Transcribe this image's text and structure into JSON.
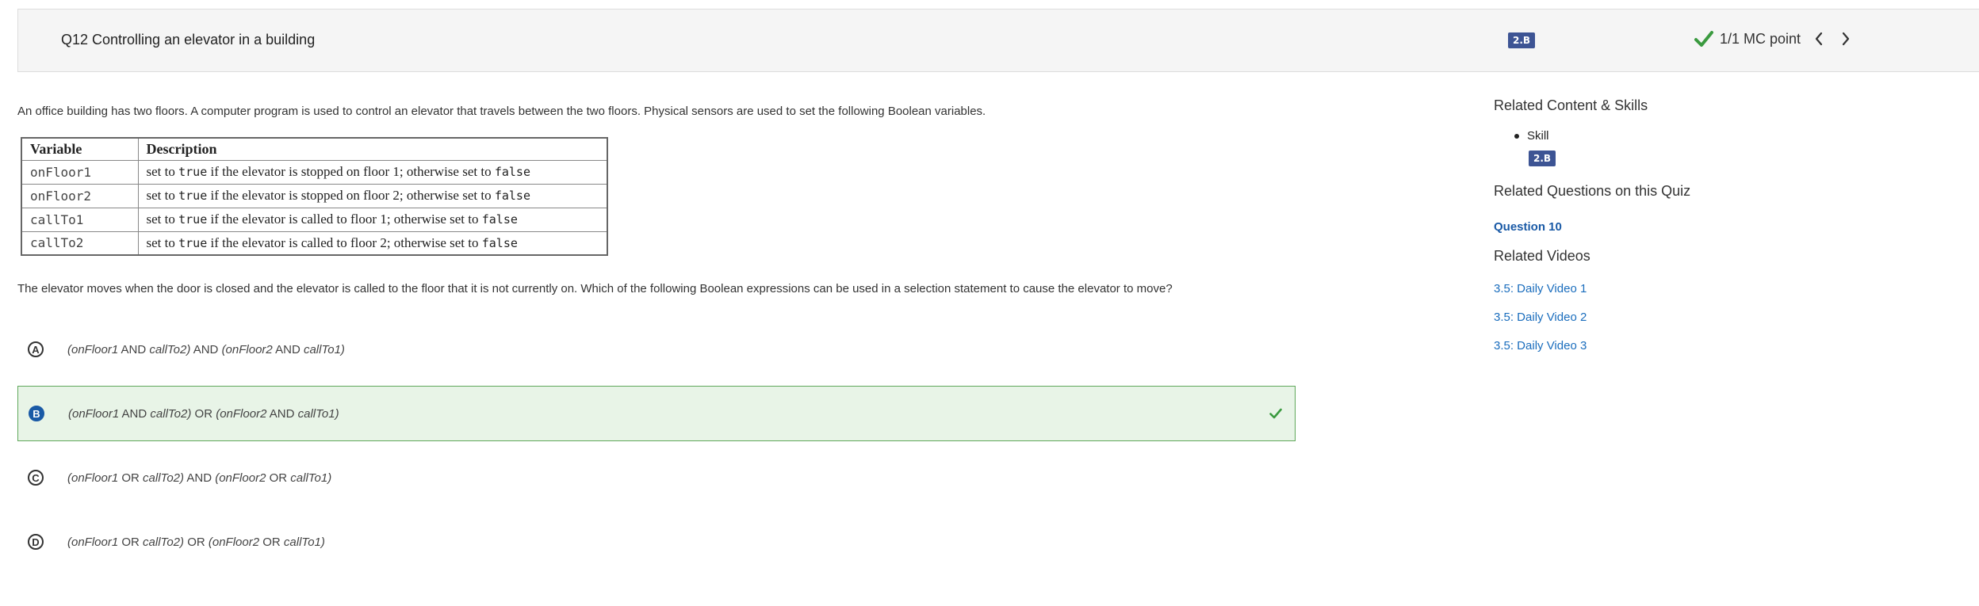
{
  "header": {
    "question_title": "Q12 Controlling an elevator in a building",
    "skill_badge": "2.B",
    "points": "1/1 MC point",
    "icons": {
      "check": "check-icon",
      "prev": "chevron-left-icon",
      "next": "chevron-right-icon"
    },
    "check_color": "#3a9a3f"
  },
  "question": {
    "stem": "An office building has two floors. A computer program is used to control an elevator that travels between the two floors. Physical sensors are used to set the following Boolean variables.",
    "table": {
      "headers": [
        "Variable",
        "Description"
      ],
      "rows": [
        {
          "variable": "onFloor1",
          "d1": "set to ",
          "t": "true",
          "d2": " if the elevator is stopped on floor 1; otherwise set to ",
          "f": "false"
        },
        {
          "variable": "onFloor2",
          "d1": "set to ",
          "t": "true",
          "d2": " if the elevator is stopped on floor 2; otherwise set to ",
          "f": "false"
        },
        {
          "variable": "callTo1",
          "d1": "set to ",
          "t": "true",
          "d2": " if the elevator is called to floor 1; otherwise set to ",
          "f": "false"
        },
        {
          "variable": "callTo2",
          "d1": "set to ",
          "t": "true",
          "d2": " if the elevator is called to floor 2; otherwise set to ",
          "f": "false"
        }
      ]
    },
    "prompt": "The elevator moves when the door is closed and the elevator is called to the floor that it is not currently on. Which of the following Boolean expressions can be used in a selection statement to cause the elevator to move?",
    "choices": [
      {
        "letter": "A",
        "a": "(onFloor1",
        "op1": " AND ",
        "b": "callTo2)",
        "mid": " AND ",
        "c": "(onFloor2",
        "op2": " AND ",
        "d": "callTo1)",
        "selected": false
      },
      {
        "letter": "B",
        "a": "(onFloor1",
        "op1": " AND ",
        "b": "callTo2)",
        "mid": " OR ",
        "c": "(onFloor2",
        "op2": " AND ",
        "d": "callTo1)",
        "selected": true
      },
      {
        "letter": "C",
        "a": "(onFloor1",
        "op1": " OR ",
        "b": "callTo2)",
        "mid": " AND ",
        "c": "(onFloor2",
        "op2": " OR ",
        "d": "callTo1)",
        "selected": false
      },
      {
        "letter": "D",
        "a": "(onFloor1",
        "op1": " OR ",
        "b": "callTo2)",
        "mid": " OR ",
        "c": "(onFloor2",
        "op2": " OR ",
        "d": "callTo1)",
        "selected": false
      }
    ],
    "selected_color": "#e8f4e7",
    "selected_border": "#5fa85a"
  },
  "sidebar": {
    "related_content_heading": "Related Content & Skills",
    "skill_label": "Skill",
    "skill_badge": "2.B",
    "related_questions_heading": "Related Questions on this Quiz",
    "related_question": "Question 10",
    "related_videos_heading": "Related Videos",
    "videos": [
      "3.5: Daily Video 1",
      "3.5: Daily Video 2",
      "3.5: Daily Video 3"
    ],
    "link_color": "#1a6dbd",
    "badge_color": "#3d5494"
  }
}
